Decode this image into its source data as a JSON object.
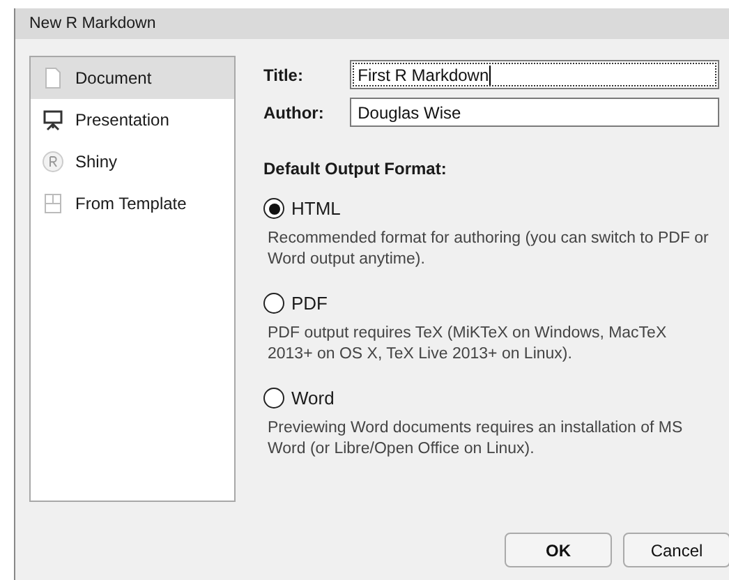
{
  "window": {
    "title": "New R Markdown"
  },
  "sidebar": {
    "items": [
      {
        "label": "Document",
        "kind": "document",
        "selected": true
      },
      {
        "label": "Presentation",
        "kind": "presentation",
        "selected": false
      },
      {
        "label": "Shiny",
        "kind": "shiny",
        "selected": false
      },
      {
        "label": "From Template",
        "kind": "template",
        "selected": false
      }
    ]
  },
  "fields": [
    {
      "label": "Title:",
      "value": "First R Markdown",
      "focused": true
    },
    {
      "label": "Author:",
      "value": "Douglas Wise",
      "focused": false
    }
  ],
  "output_format": {
    "heading": "Default Output Format:",
    "options": [
      {
        "label": "HTML",
        "description": "Recommended format for authoring (you can switch to PDF or Word output anytime).",
        "selected": true
      },
      {
        "label": "PDF",
        "description": "PDF output requires TeX (MiKTeX on Windows, MacTeX 2013+ on OS X, TeX Live 2013+ on Linux).",
        "selected": false
      },
      {
        "label": "Word",
        "description": "Previewing Word documents requires an installation of MS Word (or Libre/Open Office on Linux).",
        "selected": false
      }
    ]
  },
  "buttons": [
    {
      "label": "OK",
      "kind": "default"
    },
    {
      "label": "Cancel",
      "kind": "normal"
    }
  ]
}
